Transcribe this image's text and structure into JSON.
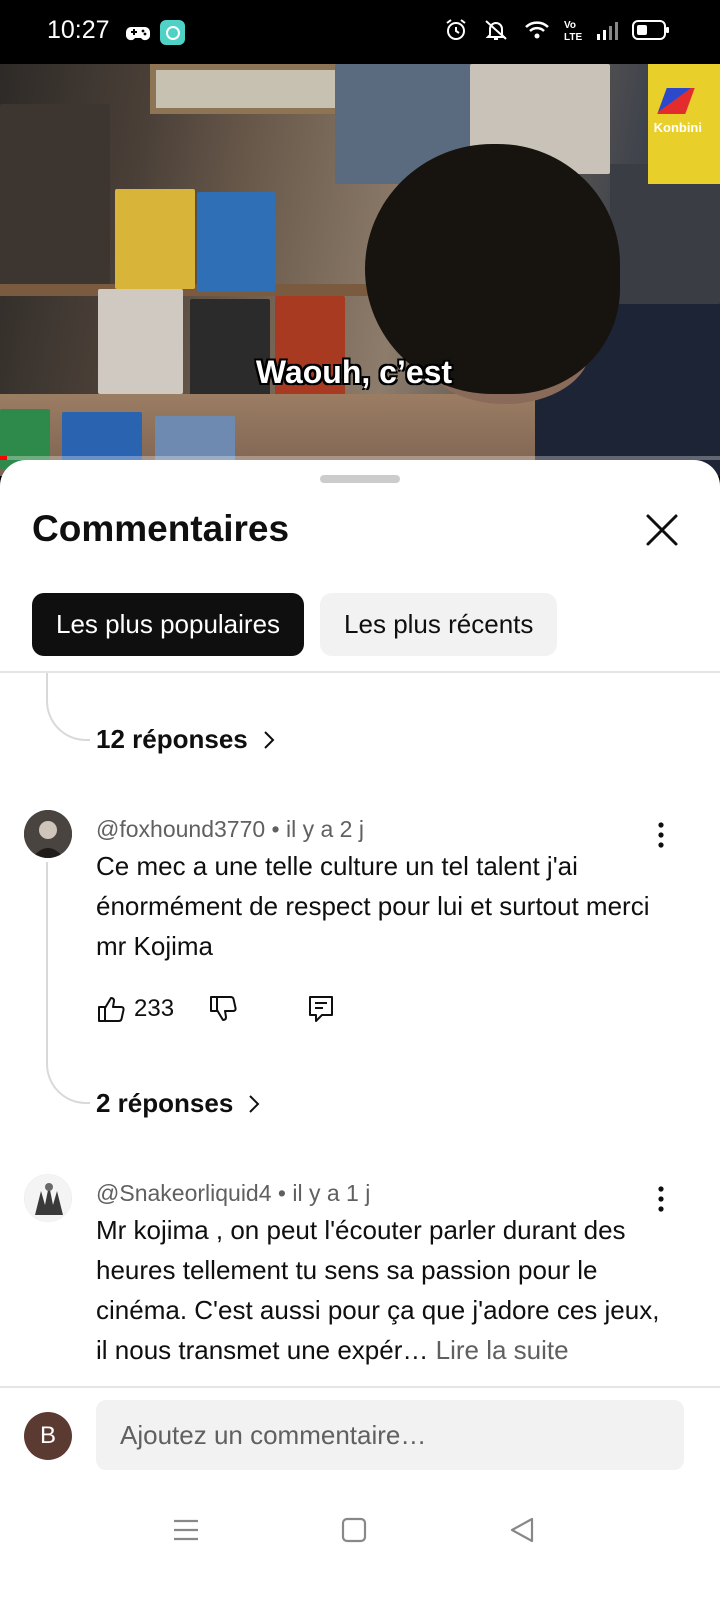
{
  "status_bar": {
    "time": "10:27",
    "icons": [
      "game-controller-icon",
      "app-icon",
      "alarm-icon",
      "mute-icon",
      "wifi-icon",
      "volte-icon",
      "signal-icon",
      "battery-icon"
    ]
  },
  "video": {
    "subtitle": "Waouh, c’est",
    "channel_logo_text": "Konbini",
    "progress_fraction": 0.01
  },
  "sheet": {
    "title": "Commentaires",
    "chips": [
      {
        "label": "Les plus populaires",
        "active": true
      },
      {
        "label": "Les plus récents",
        "active": false
      }
    ]
  },
  "threads": [
    {
      "replies_label": "12 réponses"
    }
  ],
  "comments": [
    {
      "author": "@foxhound3770",
      "time": "il y a 2 j",
      "text": "Ce mec a une telle culture un tel talent j'ai énormément de respect pour lui et surtout merci mr Kojima",
      "likes": "233",
      "replies_label": "2 réponses"
    },
    {
      "author": "@Snakeorliquid4",
      "time": "il y a 1 j",
      "text": "Mr kojima , on peut l'écouter parler durant des heures tellement tu sens sa passion pour le cinéma. C'est aussi pour ça que j'adore ces jeux, il nous transmet une expér…",
      "read_more": "Lire la suite"
    }
  ],
  "composer": {
    "avatar_letter": "B",
    "placeholder": "Ajoutez un commentaire…"
  },
  "colors": {
    "accent": "#0f0f0f",
    "secondary_text": "#606060",
    "chip_inactive": "#f2f2f2",
    "progress": "#ff0000"
  }
}
